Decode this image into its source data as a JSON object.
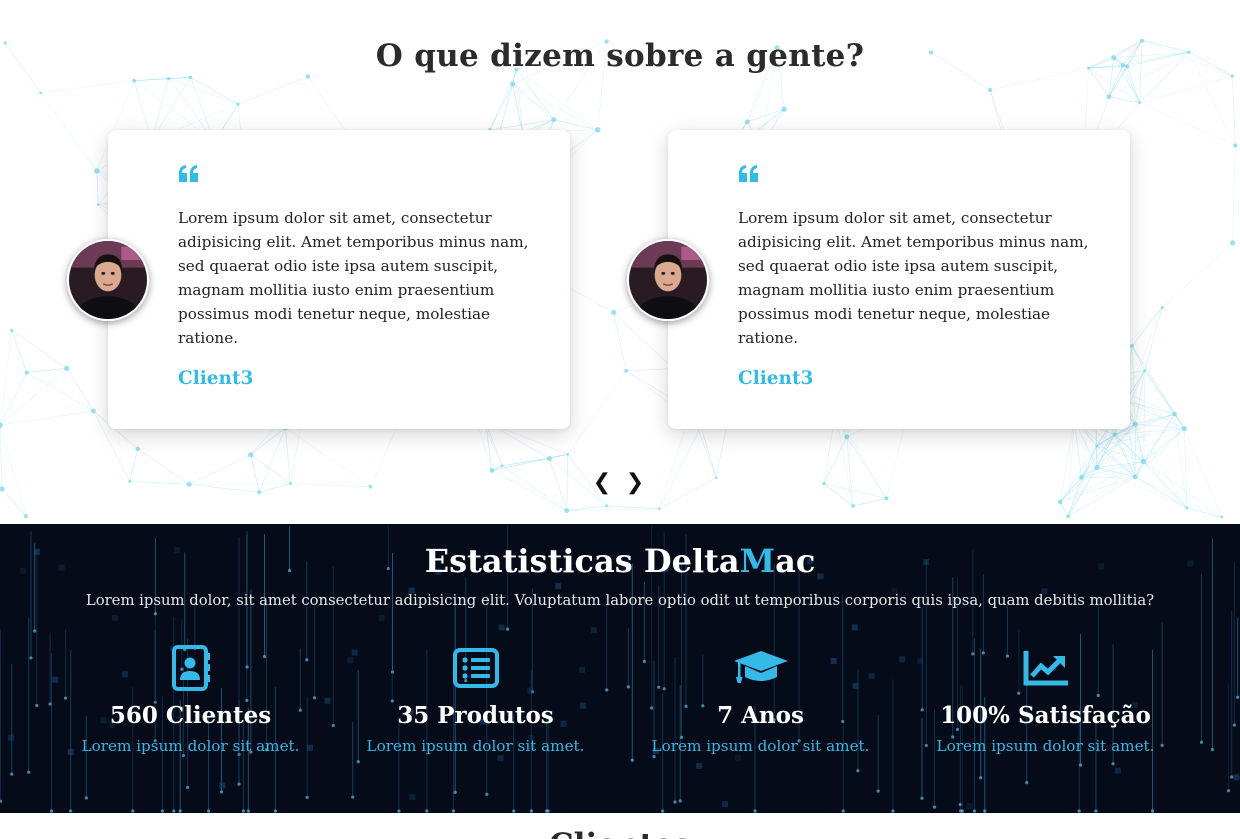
{
  "testimonials": {
    "title": "O que dizem sobre a gente?",
    "cards": [
      {
        "text": "Lorem ipsum dolor sit amet, consectetur adipisicing elit. Amet temporibus minus nam, sed quaerat odio iste ipsa autem suscipit, magnam mollitia iusto enim praesentium possimus modi tenetur neque, molestiae ratione.",
        "name": "Client3",
        "avatar": "client-photo"
      },
      {
        "text": "Lorem ipsum dolor sit amet, consectetur adipisicing elit. Amet temporibus minus nam, sed quaerat odio iste ipsa autem suscipit, magnam mollitia iusto enim praesentium possimus modi tenetur neque, molestiae ratione.",
        "name": "Client3",
        "avatar": "client-photo"
      }
    ],
    "prev_arrow": "❮",
    "next_arrow": "❯"
  },
  "stats": {
    "title_prefix": "Estatisticas Delta",
    "title_accent": "M",
    "title_suffix": "ac",
    "subtitle": "Lorem ipsum dolor, sit amet consectetur adipisicing elit. Voluptatum labore optio odit ut temporibus corporis quis ipsa, quam debitis mollitia?",
    "items": [
      {
        "icon": "address-book-icon",
        "value": "560 Clientes",
        "desc": "Lorem ipsum dolor sit amet."
      },
      {
        "icon": "list-icon",
        "value": "35 Produtos",
        "desc": "Lorem ipsum dolor sit amet."
      },
      {
        "icon": "graduation-cap-icon",
        "value": "7 Anos",
        "desc": "Lorem ipsum dolor sit amet."
      },
      {
        "icon": "chart-line-icon",
        "value": "100% Satisfação",
        "desc": "Lorem ipsum dolor sit amet."
      }
    ]
  },
  "next_section": {
    "title": "Clientes"
  },
  "colors": {
    "accent": "#35b9e6",
    "dark_bg": "#050b18",
    "heading": "#2b2b2b",
    "network_line": "#7fd6ec"
  }
}
